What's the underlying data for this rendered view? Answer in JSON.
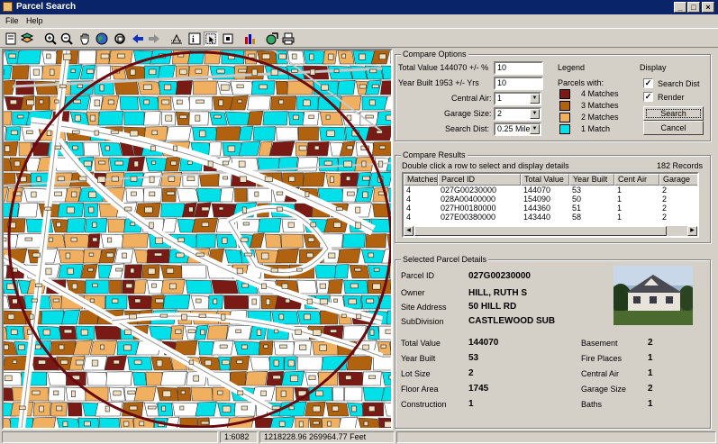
{
  "window": {
    "title": "Parcel Search",
    "min": "_",
    "max": "□",
    "close": "×"
  },
  "menu": [
    "File",
    "Help"
  ],
  "toolbar": {
    "icons": [
      "page-icon",
      "layers-icon",
      "zoom-in-icon",
      "zoom-out-icon",
      "pan-hand-icon",
      "globe-icon",
      "refresh-icon",
      "back-arrow-icon",
      "forward-arrow-icon",
      "measure-icon",
      "identify-icon",
      "select-icon",
      "clear-selection-icon",
      "chart-icon",
      "export-icon",
      "print-icon"
    ]
  },
  "compare": {
    "title": "Compare Options",
    "total_value_label": "Total Value 144070  +/- %",
    "total_value": "10",
    "year_built_label": "Year Built 1953  +/- Yrs",
    "year_built": "10",
    "central_air_label": "Central Air:",
    "central_air": "1",
    "garage_label": "Garage Size:",
    "garage": "2",
    "search_dist_label": "Search Dist:",
    "search_dist": "0.25 Mile"
  },
  "legend": {
    "title": "Legend",
    "subtitle": "Parcels with:",
    "items": [
      {
        "label": "4 Matches",
        "color": "#7a1a14"
      },
      {
        "label": "3 Matches",
        "color": "#b0620e"
      },
      {
        "label": "2 Matches",
        "color": "#f0b060"
      },
      {
        "label": "1 Match",
        "color": "#00e0e8"
      }
    ]
  },
  "display": {
    "title": "Display",
    "search_dist": "Search Dist",
    "render": "Render",
    "search_btn": "Search",
    "cancel_btn": "Cancel"
  },
  "results": {
    "title": "Compare Results",
    "hint": "Double click a row to select and display details",
    "count": "182 Records",
    "columns": [
      "Matches",
      "Parcel ID",
      "Total Value",
      "Year Built",
      "Cent Air",
      "Garage"
    ],
    "rows": [
      [
        "4",
        "027G00230000",
        "144070",
        "53",
        "1",
        "2"
      ],
      [
        "4",
        "028A00400000",
        "154090",
        "50",
        "1",
        "2"
      ],
      [
        "4",
        "027H00180000",
        "144360",
        "51",
        "1",
        "2"
      ],
      [
        "4",
        "027E00380000",
        "143440",
        "58",
        "1",
        "2"
      ]
    ]
  },
  "details": {
    "title": "Selected Parcel Details",
    "parcel_id_label": "Parcel ID",
    "parcel_id": "027G00230000",
    "owner_label": "Owner",
    "owner": "HILL, RUTH S",
    "address_label": "Site Address",
    "address": "50 HILL RD",
    "subdivision_label": "SubDivision",
    "subdivision": "CASTLEWOOD SUB",
    "left": [
      [
        "Total Value",
        "144070"
      ],
      [
        "Year Built",
        "53"
      ],
      [
        "Lot Size",
        "2"
      ],
      [
        "Floor Area",
        "1745"
      ],
      [
        "Construction",
        "1"
      ]
    ],
    "right": [
      [
        "Basement",
        "2"
      ],
      [
        "Fire Places",
        "1"
      ],
      [
        "Central Air",
        "1"
      ],
      [
        "Garage Size",
        "2"
      ],
      [
        "Baths",
        "1"
      ]
    ]
  },
  "status": {
    "scale": "1:6082",
    "coords": "1218228.96  269964.77 Feet"
  }
}
